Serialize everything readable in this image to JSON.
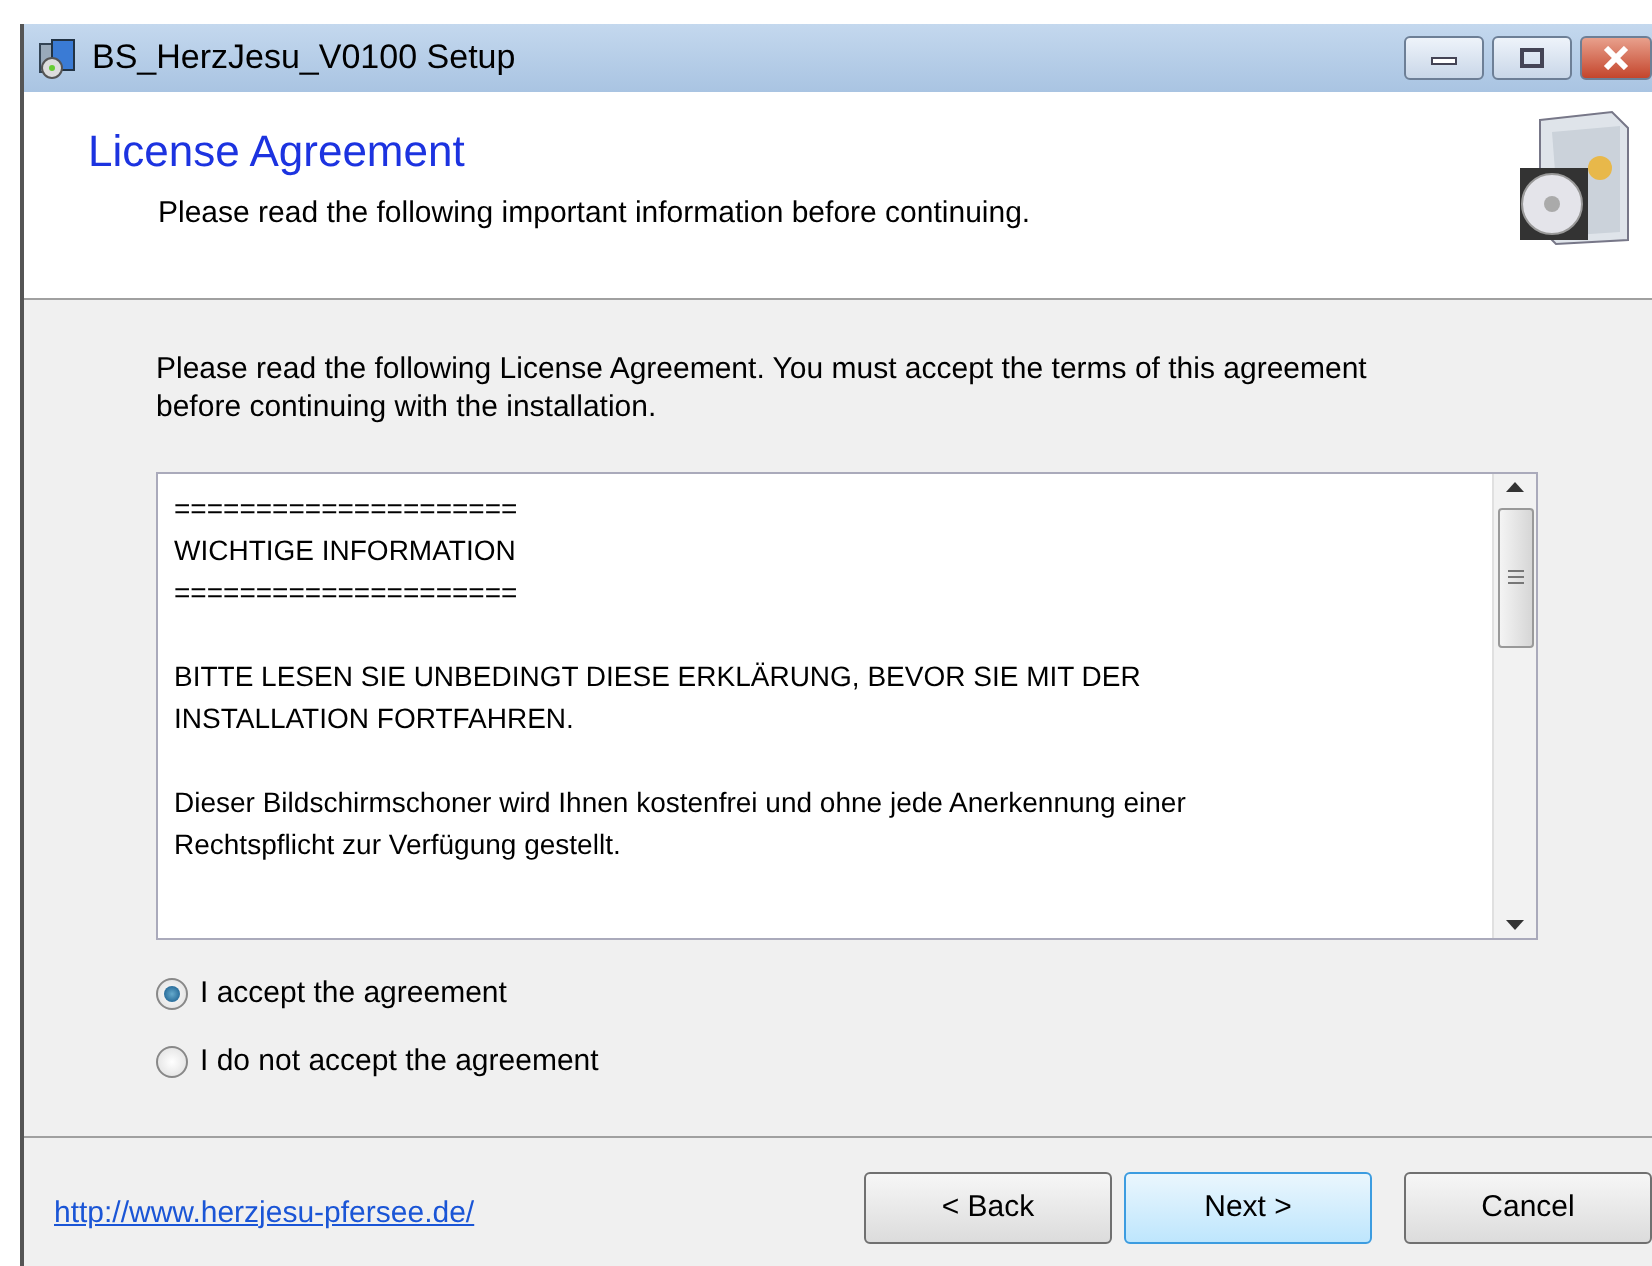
{
  "window": {
    "title": "BS_HerzJesu_V0100 Setup"
  },
  "header": {
    "title": "License Agreement",
    "subtitle": "Please read the following important information before continuing."
  },
  "intro": "Please read the following License Agreement. You must accept the terms of this agreement before continuing with the installation.",
  "license_text": [
    [
      "=====================",
      "WICHTIGE INFORMATION",
      "====================="
    ],
    [
      "BITTE LESEN SIE UNBEDINGT DIESE ERKLÄRUNG, BEVOR SIE MIT DER",
      "INSTALLATION FORTFAHREN."
    ],
    [
      "Dieser Bildschirmschoner wird Ihnen kostenfrei und ohne jede Anerkennung einer",
      "Rechtspflicht zur Verfügung gestellt."
    ]
  ],
  "options": [
    {
      "label": "I accept the agreement",
      "selected": true
    },
    {
      "label": "I do not accept the agreement",
      "selected": false
    }
  ],
  "footer": {
    "link": "http://www.herzjesu-pfersee.de/"
  },
  "buttons": [
    {
      "label": "< Back",
      "focused": false
    },
    {
      "label": "Next >",
      "focused": true
    },
    {
      "label": "Cancel",
      "focused": false
    }
  ]
}
